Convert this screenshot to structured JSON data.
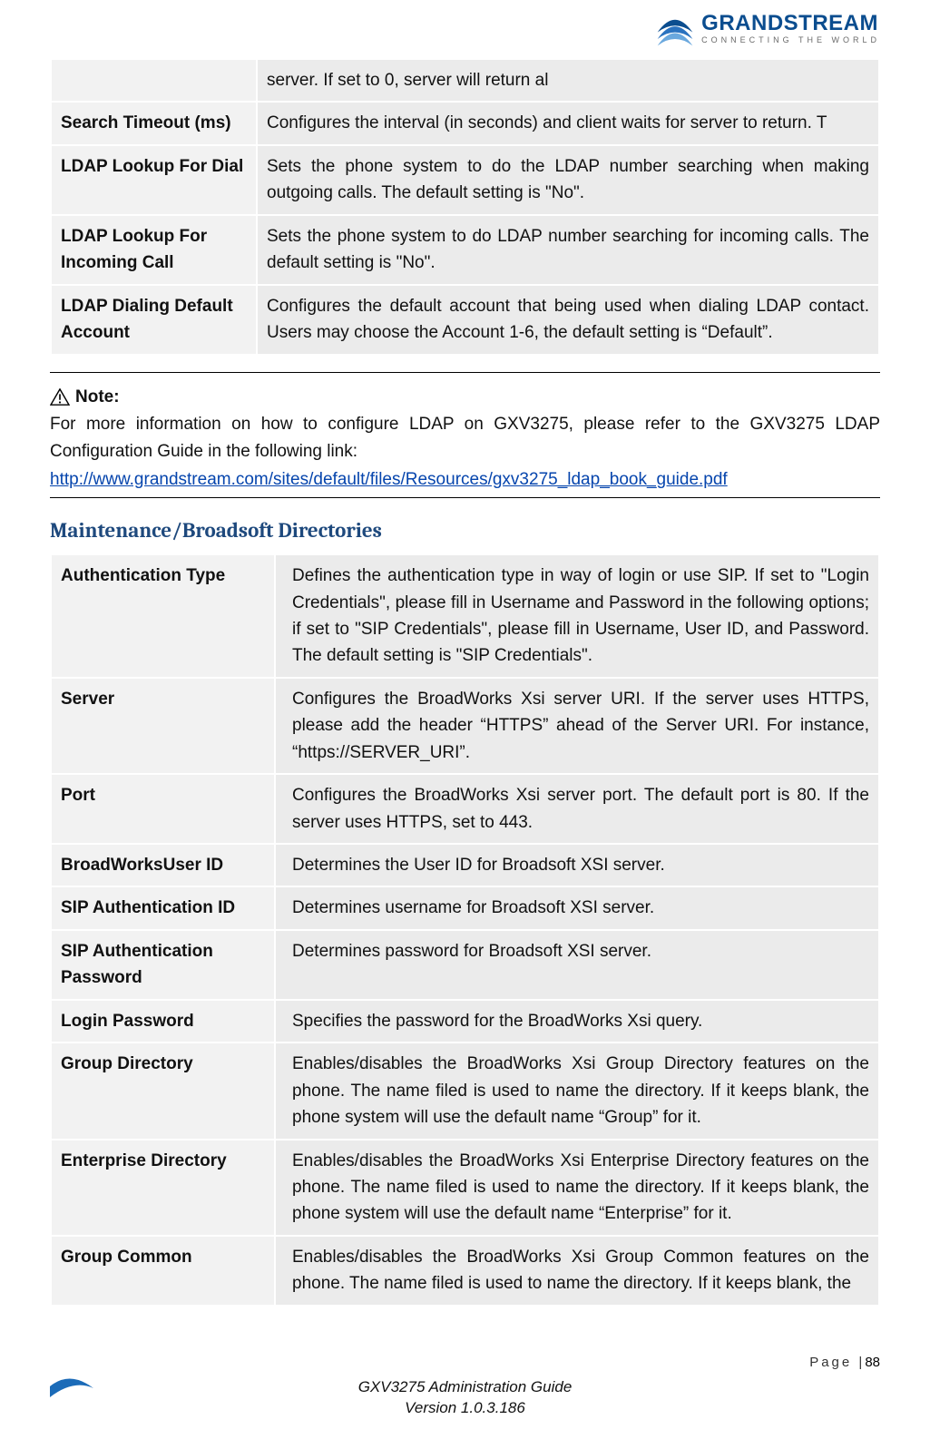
{
  "header": {
    "brand": "GRANDSTREAM",
    "tagline": "CONNECTING THE WORLD"
  },
  "table1": {
    "rows": [
      {
        "label": "",
        "desc": "server. If set to 0, server will return al"
      },
      {
        "label": "Search Timeout (ms)",
        "desc": "Configures the interval (in seconds) and client waits for server to return. T"
      },
      {
        "label": "LDAP Lookup For Dial",
        "desc": "Sets the phone system to do the LDAP number searching when making outgoing calls. The default setting is \"No\"."
      },
      {
        "label": "LDAP Lookup For Incoming Call",
        "desc": "Sets the phone system to do LDAP number searching for incoming calls. The default setting is \"No\"."
      },
      {
        "label": "LDAP Dialing Default Account",
        "desc": "Configures the default account that being used when dialing LDAP contact. Users may choose the Account 1-6, the default setting is “Default”."
      }
    ]
  },
  "note": {
    "title": "Note:",
    "body": "For more information on how to configure LDAP on GXV3275, please refer to the GXV3275 LDAP Configuration Guide in the following link:",
    "link": "http://www.grandstream.com/sites/default/files/Resources/gxv3275_ldap_book_guide.pdf"
  },
  "section2": {
    "title": "Maintenance/Broadsoft Directories"
  },
  "table2": {
    "rows": [
      {
        "label": "Authentication Type",
        "desc": "Defines the authentication type in way of login or use SIP. If set to \"Login Credentials\", please fill in Username and Password in the following options; if set to \"SIP Credentials\", please fill in Username, User ID, and Password. The default setting is \"SIP Credentials\"."
      },
      {
        "label": "Server",
        "desc": "Configures the BroadWorks Xsi server URI. If the server uses HTTPS, please add the header “HTTPS” ahead of the Server URI. For instance, “https://SERVER_URI”."
      },
      {
        "label": "Port",
        "desc": "Configures the BroadWorks Xsi server port. The default port is 80. If the server uses HTTPS, set to 443."
      },
      {
        "label": "BroadWorksUser ID",
        "desc": "Determines the User ID for Broadsoft XSI server."
      },
      {
        "label": "SIP Authentication ID",
        "desc": "Determines username for Broadsoft XSI server."
      },
      {
        "label": "SIP Authentication Password",
        "desc": "Determines password for Broadsoft XSI server."
      },
      {
        "label": "Login Password",
        "desc": "Specifies the password for the BroadWorks Xsi query."
      },
      {
        "label": "Group Directory",
        "desc": "Enables/disables the BroadWorks Xsi Group Directory features on the phone. The name filed is used to name the directory. If it keeps blank, the phone system will use the default name “Group” for it."
      },
      {
        "label": "Enterprise Directory",
        "desc": "Enables/disables the BroadWorks Xsi Enterprise Directory features on the phone. The name filed is used to name the directory. If it keeps blank, the phone system will use the default name “Enterprise” for it."
      },
      {
        "label": "Group Common",
        "desc": "Enables/disables the BroadWorks Xsi Group Common features on the phone. The name filed is used to name the directory. If it keeps blank, the"
      }
    ]
  },
  "footer": {
    "page_label": "Page |",
    "page_num": "88",
    "doc_title": "GXV3275 Administration Guide",
    "doc_version": "Version 1.0.3.186"
  }
}
